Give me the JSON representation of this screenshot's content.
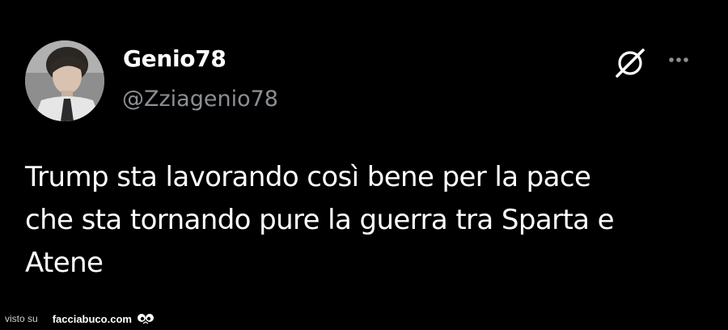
{
  "author": {
    "display_name": "Genio78",
    "handle": "@Zziagenio78",
    "avatar_icon": "profile-photo"
  },
  "actions": {
    "grok_icon": "grok-icon",
    "more_icon": "more-options-icon"
  },
  "tweet": {
    "text": "Trump sta lavorando così bene per la pace\nche sta tornando pure la guerra tra Sparta e\nAtene"
  },
  "watermark": {
    "prefix": "visto su",
    "brand": "facciabuco.com"
  },
  "colors": {
    "background": "#000000",
    "text": "#ffffff",
    "secondary": "#8b8f94"
  }
}
